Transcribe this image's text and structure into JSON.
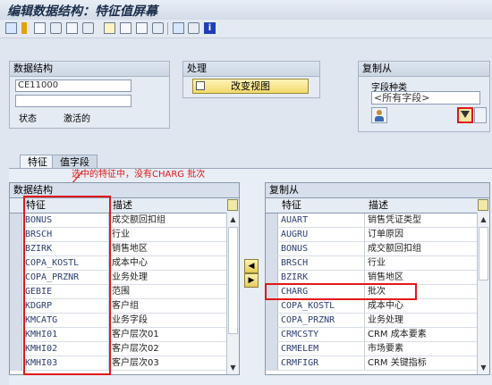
{
  "window": {
    "title": "编辑数据结构：特征值屏幕"
  },
  "toolbar": {
    "icons": [
      "save-icon",
      "back-icon",
      "hierarchy-icon",
      "grid-icon",
      "print-icon",
      "export-icon",
      "list-icon",
      "cut-icon",
      "copy-icon",
      "paste-icon",
      "find-icon",
      "info-icon"
    ]
  },
  "data_structure": {
    "group_title": "数据结构",
    "field1_value": "CE11000",
    "field2_value": "",
    "status_label": "状态",
    "status_value": "激活的"
  },
  "processing": {
    "group_title": "处理",
    "change_view_label": "改变视图"
  },
  "copy_from": {
    "group_title": "复制从",
    "field_type_label": "字段种类",
    "field_type_value": "<所有字段>"
  },
  "tabs": [
    {
      "label": "特征",
      "active": true
    },
    {
      "label": "值字段",
      "active": false
    }
  ],
  "annotation": "选中的特征中，没有CHARG 批次",
  "left_table": {
    "title": "数据结构",
    "col_characteristic": "特征",
    "col_description": "描述",
    "rows": [
      {
        "code": "BONUS",
        "desc": "成交额回扣组"
      },
      {
        "code": "BRSCH",
        "desc": "行业"
      },
      {
        "code": "BZIRK",
        "desc": "销售地区"
      },
      {
        "code": "COPA_KOSTL",
        "desc": "成本中心"
      },
      {
        "code": "COPA_PRZNR",
        "desc": "业务处理"
      },
      {
        "code": "GEBIE",
        "desc": "范围"
      },
      {
        "code": "KDGRP",
        "desc": "客户组"
      },
      {
        "code": "KMCATG",
        "desc": "业务字段"
      },
      {
        "code": "KMHI01",
        "desc": "客户层次01"
      },
      {
        "code": "KMHI02",
        "desc": "客户层次02"
      },
      {
        "code": "KMHI03",
        "desc": "客户层次03"
      }
    ]
  },
  "right_table": {
    "title": "复制从",
    "col_characteristic": "特征",
    "col_description": "描述",
    "rows": [
      {
        "code": "AUART",
        "desc": "销售凭证类型"
      },
      {
        "code": "AUGRU",
        "desc": "订单原因"
      },
      {
        "code": "BONUS",
        "desc": "成交额回扣组"
      },
      {
        "code": "BRSCH",
        "desc": "行业"
      },
      {
        "code": "BZIRK",
        "desc": "销售地区"
      },
      {
        "code": "CHARG",
        "desc": "批次"
      },
      {
        "code": "COPA_KOSTL",
        "desc": "成本中心"
      },
      {
        "code": "COPA_PRZNR",
        "desc": "业务处理"
      },
      {
        "code": "CRMCSTY",
        "desc": "CRM 成本要素"
      },
      {
        "code": "CRMELEM",
        "desc": "市场要素"
      },
      {
        "code": "CRMFIGR",
        "desc": "CRM 关键指标"
      }
    ]
  },
  "colors": {
    "highlight": "#e21818",
    "button_yellow": "#f1d96c",
    "background": "#dfe6ef"
  }
}
